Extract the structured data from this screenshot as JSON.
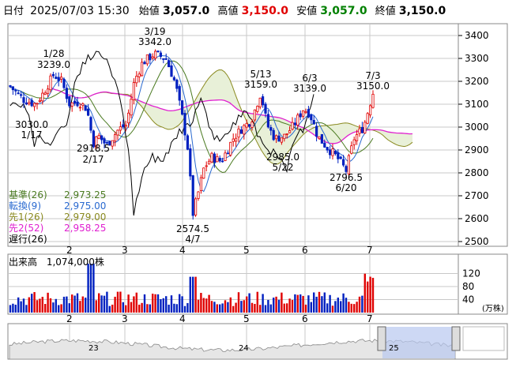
{
  "header": {
    "date_label": "日付",
    "datetime": "2025/07/03 15:30",
    "open_label": "始値",
    "open": "3,057.0",
    "high_label": "高値",
    "high": "3,150.0",
    "low_label": "安値",
    "low": "3,057.0",
    "close_label": "終値",
    "close": "3,150.0",
    "colors": {
      "high": "#e00000",
      "low": "#008000",
      "label": "#000000"
    }
  },
  "indicators": [
    {
      "label": "基準(26)",
      "value": "2,973.25",
      "color": "#4a7a20"
    },
    {
      "label": "転換(9)",
      "value": "2,975.00",
      "color": "#2a6ad0"
    },
    {
      "label": "先1(26)",
      "value": "2,979.00",
      "color": "#8a8a20"
    },
    {
      "label": "先2(52)",
      "value": "2,958.25",
      "color": "#e020d0"
    },
    {
      "label": "遅行(26)",
      "value": "",
      "color": "#000000"
    }
  ],
  "volume": {
    "label": "出来高",
    "value": "1,074,000株",
    "unit": "(万株)"
  },
  "chart_data": {
    "type": "candlestick",
    "price_axis": {
      "ticks": [
        3400,
        3300,
        3200,
        3100,
        3000,
        2900,
        2800,
        2700,
        2600,
        2500
      ],
      "range": [
        2480,
        3460
      ]
    },
    "volume_axis": {
      "ticks": [
        120,
        80,
        40
      ],
      "range": [
        0,
        160
      ]
    },
    "month_labels": [
      "2",
      "3",
      "4",
      "5",
      "6",
      "7"
    ],
    "navigator_labels": [
      "23",
      "24",
      "25"
    ],
    "annotations": [
      {
        "text": "1/28",
        "value": "3239.0"
      },
      {
        "text": "3/19",
        "value": "3342.0"
      },
      {
        "text": "5/13",
        "value": "3159.0"
      },
      {
        "text": "6/3",
        "value": "3139.0"
      },
      {
        "text": "7/3",
        "value": "3150.0"
      },
      {
        "text": "1/17",
        "value": "3030.0"
      },
      {
        "text": "2/17",
        "value": "2918.5"
      },
      {
        "text": "4/7",
        "value": "2574.5"
      },
      {
        "text": "5/22",
        "value": "2985.0"
      },
      {
        "text": "6/20",
        "value": "2796.5"
      }
    ],
    "colors": {
      "up": "#e00000",
      "down": "#0020c0",
      "grid": "#c8c8c8",
      "cloud": "#e8f0d8",
      "kijun": "#4a7a20",
      "tenkan": "#2a6ad0",
      "senkou1": "#8a8a20",
      "senkou2": "#e020d0",
      "chikou": "#000000",
      "volume_up": "#e00000",
      "volume_down": "#0020c0"
    }
  }
}
